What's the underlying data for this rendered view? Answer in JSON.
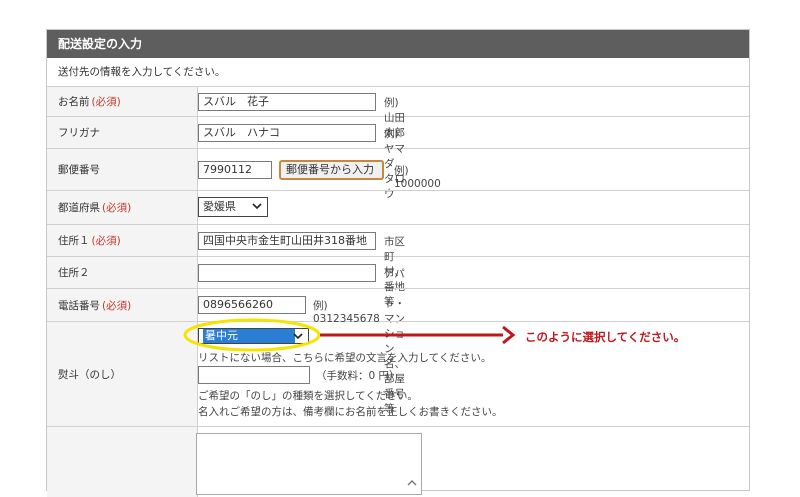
{
  "section": {
    "title": "配送設定の入力",
    "notice": "送付先の情報を入力してください。"
  },
  "fields": {
    "name": {
      "label": "お名前",
      "required": "(必須)",
      "value": "スバル　花子",
      "example": "例) 山田　太郎"
    },
    "furigana": {
      "label": "フリガナ",
      "value": "スバル　ハナコ",
      "example": "例) ヤマダ　タロウ"
    },
    "postal": {
      "label": "郵便番号",
      "value": "7990112",
      "button": "郵便番号から入力",
      "example": "例) 1000000"
    },
    "prefecture": {
      "label": "都道府県",
      "required": "(必須)",
      "value": "愛媛県"
    },
    "address1": {
      "label": "住所１",
      "required": "(必須)",
      "value": "四国中央市金生町山田井318番地",
      "example": "市区町村、番地等"
    },
    "address2": {
      "label": "住所２",
      "value": "",
      "example": "アパート・マンション名、部屋番号等"
    },
    "phone": {
      "label": "電話番号",
      "required": "(必須)",
      "value": "0896566260",
      "example": "例) 0312345678"
    },
    "noshi": {
      "label": "熨斗（のし）",
      "selected": "暑中元",
      "custom_note": "リストにない場合、こちらに希望の文言を入力してください。",
      "custom_value": "",
      "fee": "（手数料：0 円）",
      "guide_1": "ご希望の「のし」の種類を選択してください。",
      "guide_2": "名入れご希望の方は、備考欄にお名前を正しくお書きください。"
    }
  },
  "annotation": {
    "text": "このように選択してください。",
    "color": "#c0171c",
    "highlight_color": "#f5e400"
  }
}
